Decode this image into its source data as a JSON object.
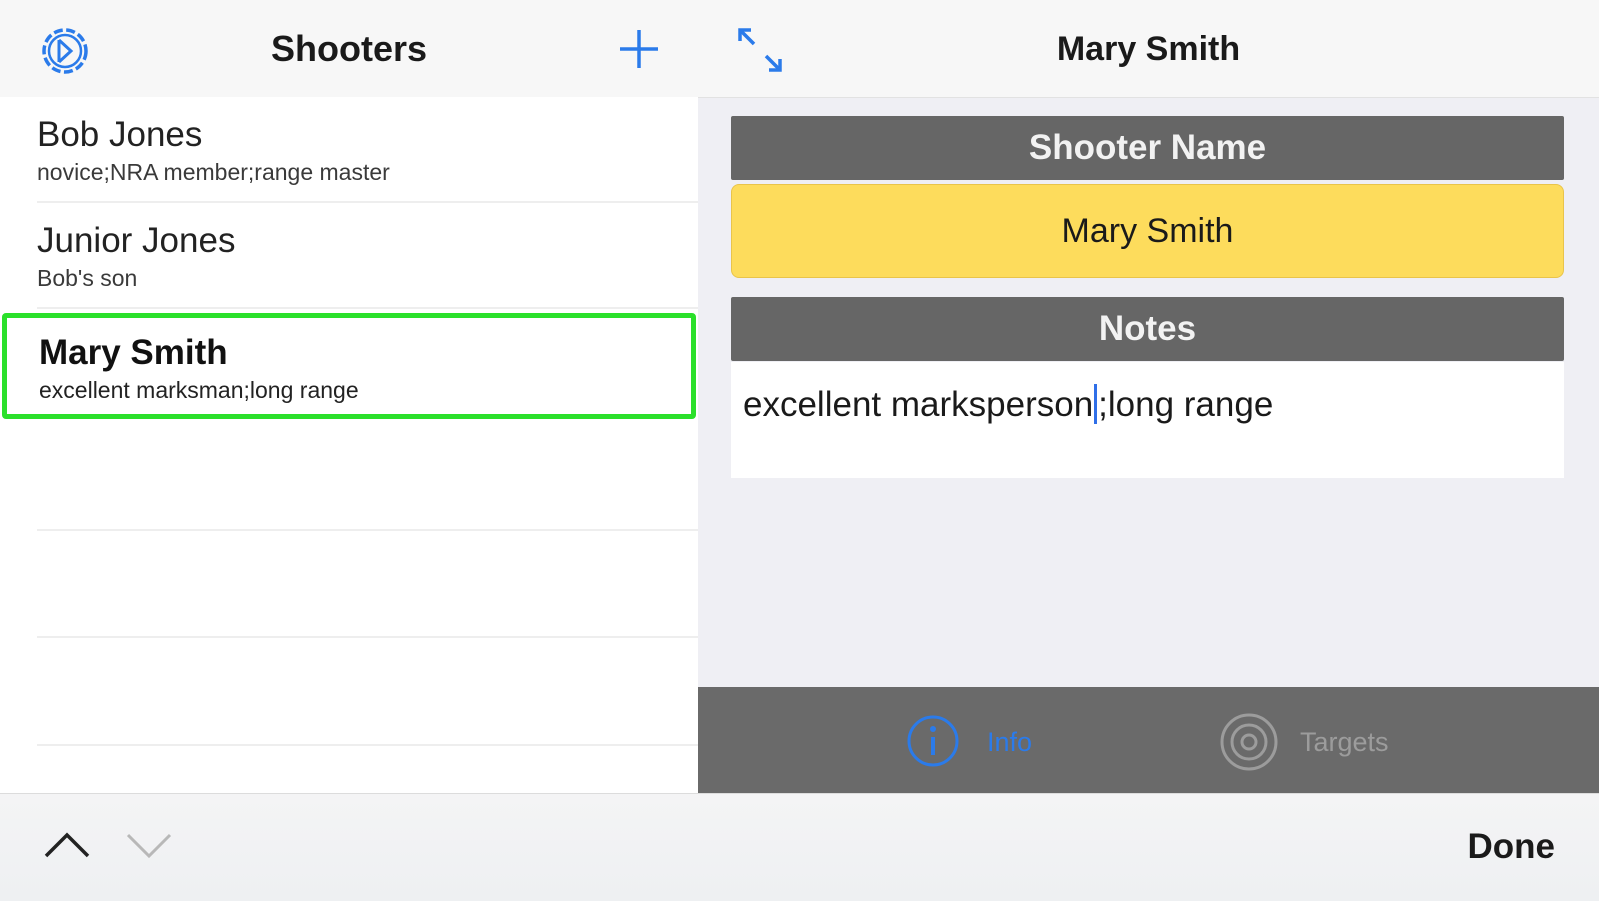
{
  "master": {
    "title": "Shooters",
    "shooters": [
      {
        "name": "Bob Jones",
        "notes": "novice;NRA member;range master"
      },
      {
        "name": "Junior Jones",
        "notes": "Bob's son"
      },
      {
        "name": "Mary Smith",
        "notes": "excellent marksman;long range"
      }
    ]
  },
  "detail": {
    "title": "Mary Smith",
    "name_header": "Shooter Name",
    "name_value": "Mary Smith",
    "notes_header": "Notes",
    "notes_before_cursor": "excellent marksperson",
    "notes_after_cursor": ";long range"
  },
  "tabs": [
    {
      "label": "Info",
      "icon": "info-icon",
      "selected": true
    },
    {
      "label": "Targets",
      "icon": "target-icon",
      "selected": false
    }
  ],
  "toolbar": {
    "done_label": "Done"
  },
  "colors": {
    "accent": "#2b7bea",
    "selection_border": "#2be02b",
    "name_field": "#fddc5c",
    "section_header": "#666666",
    "tab_bar": "#6a6a6a"
  }
}
